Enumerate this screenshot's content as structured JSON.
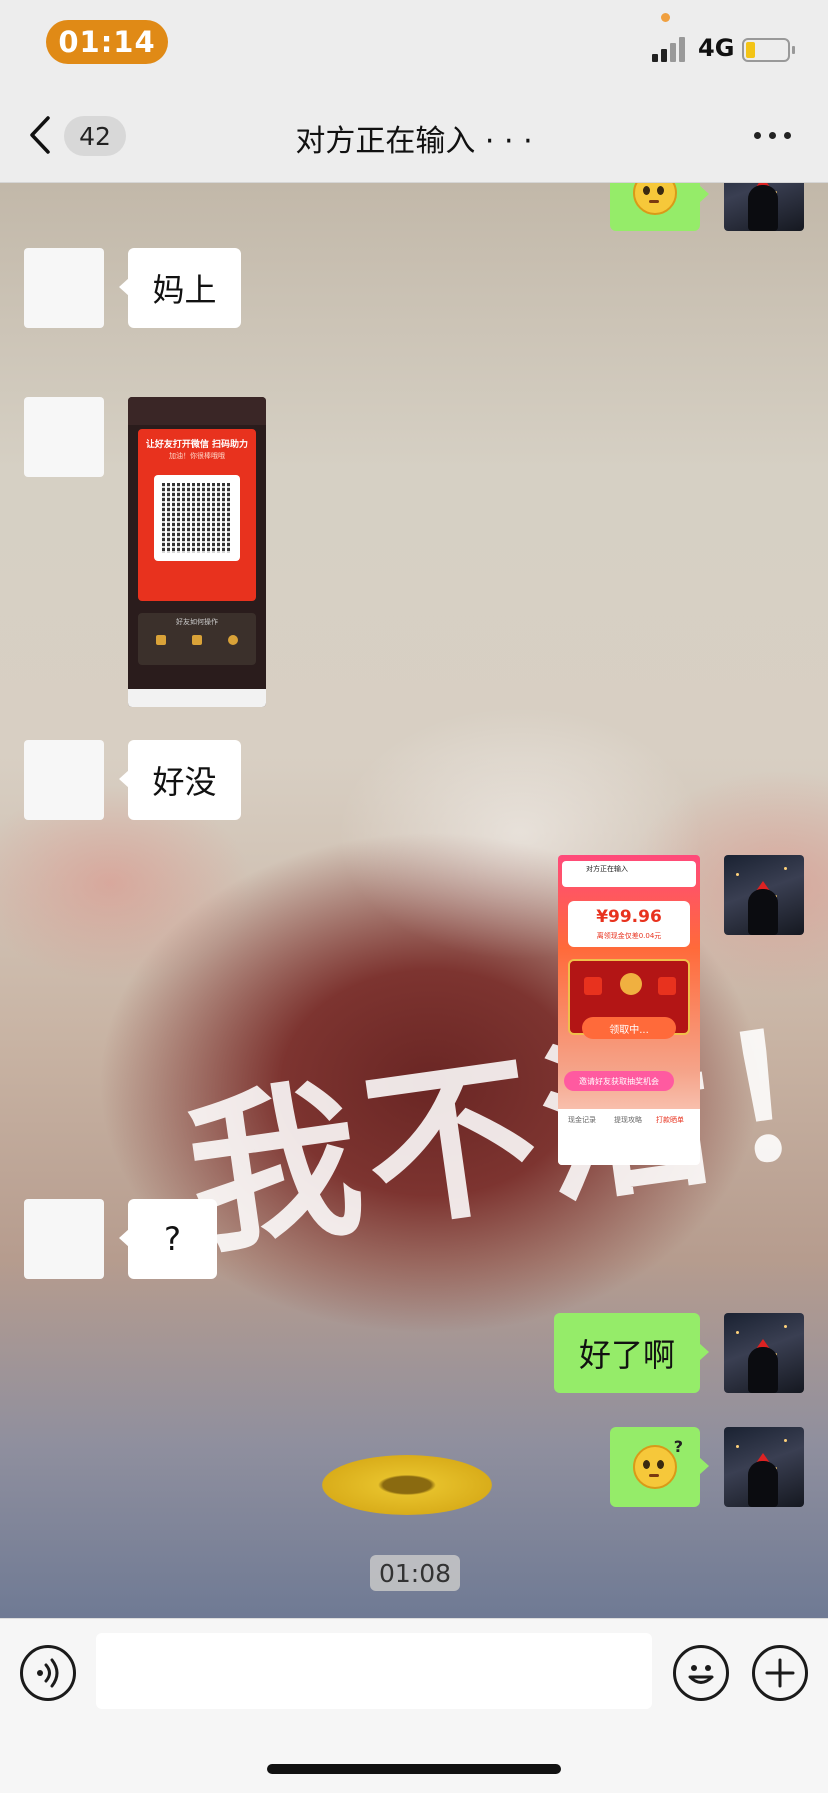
{
  "status_bar": {
    "time": "01:14",
    "network": "4G",
    "battery_level": 0.18
  },
  "nav": {
    "unread_count": "42",
    "title": "对方正在输入 · · ·"
  },
  "chat": {
    "background_caption": "我不活！",
    "timestamp": "01:08",
    "messages": [
      {
        "side": "out",
        "type": "emoji",
        "emoji": "thinking-face"
      },
      {
        "side": "in",
        "type": "text",
        "text": "妈上"
      },
      {
        "side": "in",
        "type": "image",
        "screenshot": {
          "card_title": "让好友打开微信 扫码助力",
          "card_sub": "加油！你很棒哦哦",
          "footer": "好友如何操作"
        }
      },
      {
        "side": "in",
        "type": "text",
        "text": "好没"
      },
      {
        "side": "out",
        "type": "image",
        "screenshot": {
          "header": "对方正在输入",
          "amount": "¥99.96",
          "note": "离领现金仅差0.04元",
          "button": "领取中...",
          "invite": "邀请好友获取抽奖机会",
          "tabs": [
            "现金记录",
            "提现攻略",
            "打款晒单"
          ]
        }
      },
      {
        "side": "in",
        "type": "text",
        "text": "?"
      },
      {
        "side": "out",
        "type": "text",
        "text": "好了啊"
      },
      {
        "side": "out",
        "type": "emoji",
        "emoji": "thinking-face"
      }
    ]
  },
  "input_bar": {
    "value": "",
    "placeholder": ""
  },
  "colors": {
    "time_pill": "#e08a16",
    "bubble_out": "#95ec69",
    "bubble_in": "#ffffff",
    "nav_bg": "#ededed"
  }
}
